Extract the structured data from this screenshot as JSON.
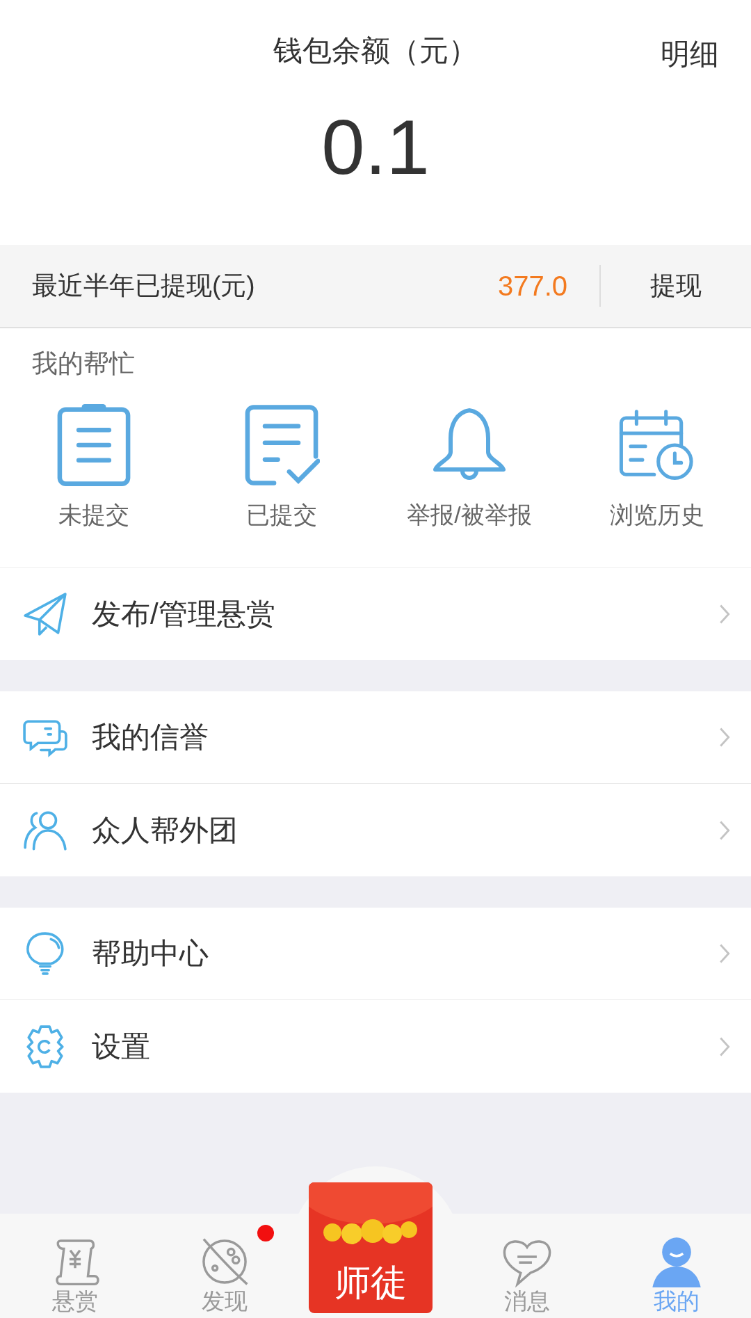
{
  "wallet": {
    "title": "钱包余额（元）",
    "detail_link": "明细",
    "balance": "0.1"
  },
  "withdraw": {
    "label": "最近半年已提现(元)",
    "amount": "377.0",
    "button": "提现"
  },
  "my_help": {
    "title": "我的帮忙",
    "items": [
      {
        "kind": "clipboard",
        "label": "未提交"
      },
      {
        "kind": "checked-doc",
        "label": "已提交"
      },
      {
        "kind": "bell",
        "label": "举报/被举报"
      },
      {
        "kind": "calendar",
        "label": "浏览历史"
      }
    ]
  },
  "menu_groups": [
    [
      {
        "kind": "plane",
        "label": "发布/管理悬赏"
      }
    ],
    [
      {
        "kind": "chat",
        "label": "我的信誉"
      },
      {
        "kind": "people",
        "label": "众人帮外团"
      }
    ],
    [
      {
        "kind": "bulb",
        "label": "帮助中心"
      },
      {
        "kind": "gear",
        "label": "设置"
      }
    ]
  ],
  "tab_bar": [
    {
      "kind": "scroll",
      "label": "悬赏",
      "selected": false,
      "badge": false
    },
    {
      "kind": "planet",
      "label": "发现",
      "selected": false,
      "badge": true
    },
    {
      "kind": "center",
      "label": "师徒",
      "selected": false,
      "badge": false
    },
    {
      "kind": "heart-chat",
      "label": "消息",
      "selected": false,
      "badge": false
    },
    {
      "kind": "person",
      "label": "我的",
      "selected": true,
      "badge": false
    }
  ]
}
